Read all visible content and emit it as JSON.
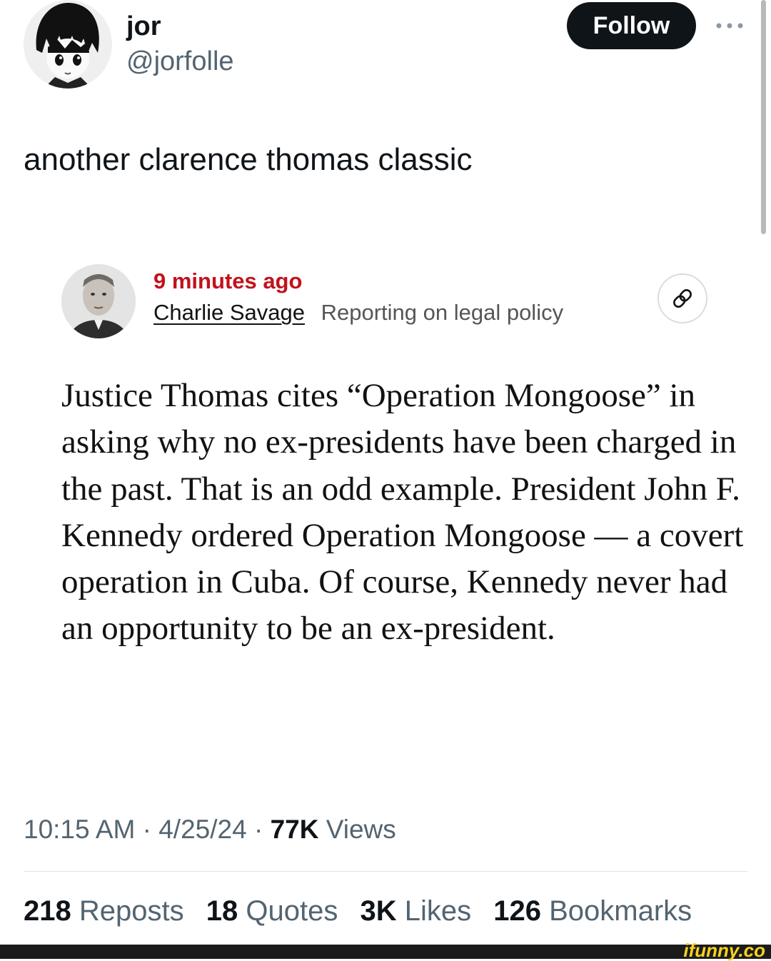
{
  "author": {
    "display_name": "jor",
    "handle": "@jorfolle",
    "follow_label": "Follow"
  },
  "tweet": {
    "text": "another clarence thomas classic"
  },
  "quoted_post": {
    "time_ago": "9 minutes ago",
    "reporter_name": "Charlie Savage",
    "beat": "Reporting on legal policy",
    "body": "Justice Thomas cites “Operation Mongoose” in asking why no ex-presidents have been charged in the past. That is an odd example. President John F. Kennedy ordered Operation Mongoose — a covert operation in Cuba. Of course, Kennedy never had an opportunity to be an ex-president.",
    "accent_color": "#c2111c"
  },
  "meta": {
    "time": "10:15 AM",
    "date": "4/25/24",
    "views_count": "77K",
    "views_label": "Views"
  },
  "stats": [
    {
      "count": "218",
      "label": "Reposts"
    },
    {
      "count": "18",
      "label": "Quotes"
    },
    {
      "count": "3K",
      "label": "Likes"
    },
    {
      "count": "126",
      "label": "Bookmarks"
    }
  ],
  "watermark": "ifunny.co"
}
